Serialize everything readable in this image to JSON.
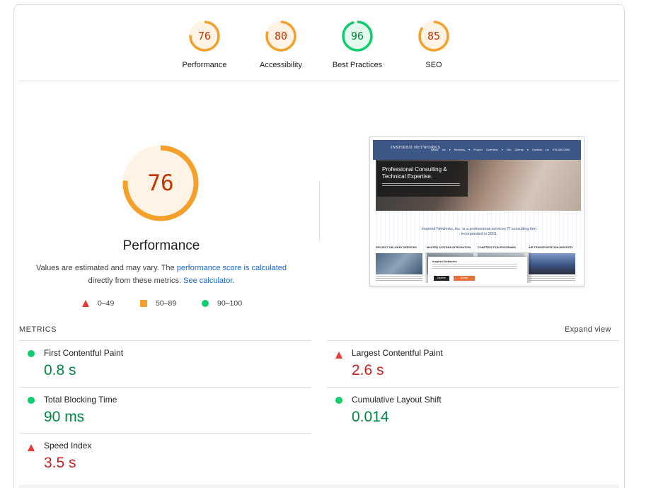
{
  "categories": [
    {
      "score": "76",
      "label": "Performance",
      "color": "#f4a02a",
      "text_color": "#c33300",
      "fraction": 0.76
    },
    {
      "score": "80",
      "label": "Accessibility",
      "color": "#f4a02a",
      "text_color": "#c33300",
      "fraction": 0.8
    },
    {
      "score": "96",
      "label": "Best Practices",
      "color": "#0cce6b",
      "text_color": "#018642",
      "fraction": 0.96
    },
    {
      "score": "85",
      "label": "SEO",
      "color": "#f4a02a",
      "text_color": "#c33300",
      "fraction": 0.85
    }
  ],
  "performance": {
    "score": "76",
    "fraction": 0.76,
    "title": "Performance",
    "desc_part1": "Values are estimated and may vary. The ",
    "desc_link1": "performance score is calculated",
    "desc_part2": " directly from these metrics. ",
    "desc_link2": "See calculator",
    "desc_part3": "."
  },
  "legend": [
    {
      "range": "0–49",
      "icon": "triangle-red-icon"
    },
    {
      "range": "50–89",
      "icon": "square-orange-icon"
    },
    {
      "range": "90–100",
      "icon": "circle-green-icon"
    }
  ],
  "thumbnail": {
    "logo": "INSPIRED NETWORKS",
    "nav": "About Us ▾  Services ▾  Project Overview ▾  Our Clients ▾  Contact Us  678.000.0000",
    "hero_title": "Professional Consulting & Technical Expertise.",
    "tagline": "Inspired Networks, Inc. is a professional services IT consulting firm incorporated in 2001",
    "columns": [
      "PROJECT DELIVERY SERVICES",
      "MASTER SYSTEMS INTEGRATION",
      "CONSTRUCTION PROGRAMS",
      "AIR TRANSPORTATION INDUSTRY"
    ],
    "modal_title": "Inspired Networks",
    "modal_decline": "Decline",
    "modal_accept": "Accept"
  },
  "metrics": {
    "title": "METRICS",
    "expand": "Expand view",
    "items": [
      {
        "name": "First Contentful Paint",
        "value": "0.8 s",
        "status": "good"
      },
      {
        "name": "Largest Contentful Paint",
        "value": "2.6 s",
        "status": "bad"
      },
      {
        "name": "Total Blocking Time",
        "value": "90 ms",
        "status": "good"
      },
      {
        "name": "Cumulative Layout Shift",
        "value": "0.014",
        "status": "good"
      },
      {
        "name": "Speed Index",
        "value": "3.5 s",
        "status": "bad"
      }
    ]
  },
  "colors": {
    "orange": "#f4a02a",
    "green": "#0cce6b",
    "red": "#eb3a34",
    "link": "#1a66d9"
  }
}
